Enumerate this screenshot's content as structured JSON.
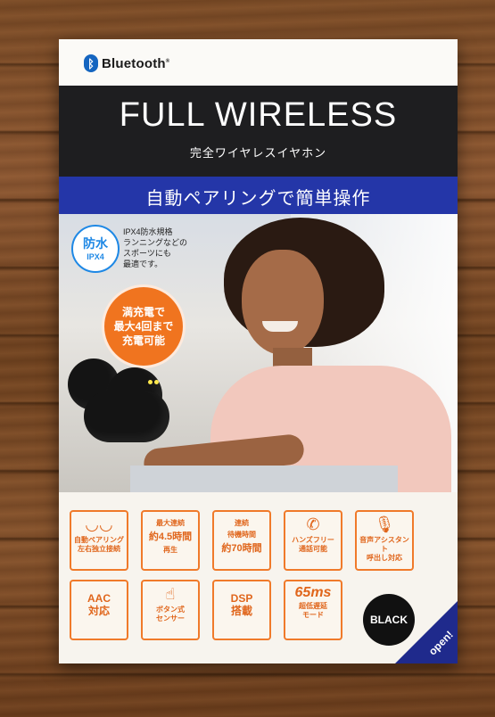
{
  "brand": {
    "logo_text": "Bluetooth",
    "mark": "®"
  },
  "title": "FULL WIRELESS",
  "subtitle": "完全ワイヤレスイヤホン",
  "headline": "自動ペアリングで簡単操作",
  "water_badge": {
    "line1": "防水",
    "line2": "IPX4"
  },
  "water_note": [
    "IPX4防水規格",
    "ランニングなどの",
    "スポーツにも",
    "最適です。"
  ],
  "charge_badge": [
    "満充電で",
    "最大4回まで",
    "充電可能"
  ],
  "features_row1": [
    {
      "icon": "earbuds-icon",
      "lines": [
        "自動ペアリング",
        "左右独立接続"
      ]
    },
    {
      "icon": "",
      "lines": [
        "最大連続",
        "約4.5時間",
        "再生"
      ]
    },
    {
      "icon": "",
      "lines": [
        "連続",
        "待機時間",
        "約70時間"
      ]
    },
    {
      "icon": "phone-icon",
      "lines": [
        "ハンズフリー",
        "通話可能"
      ]
    },
    {
      "icon": "mic-icon",
      "lines": [
        "音声アシスタント",
        "呼出し対応"
      ]
    }
  ],
  "features_row2": [
    {
      "icon": "",
      "lines": [
        "AAC",
        "対応"
      ]
    },
    {
      "icon": "touch-icon",
      "lines": [
        "ボタン式",
        "センサー"
      ]
    },
    {
      "icon": "",
      "lines": [
        "DSP",
        "搭載"
      ]
    },
    {
      "icon": "",
      "lines": [
        "65ms",
        "超低遅延",
        "モード"
      ]
    }
  ],
  "color_badge": "BLACK",
  "open_tab": "open!"
}
